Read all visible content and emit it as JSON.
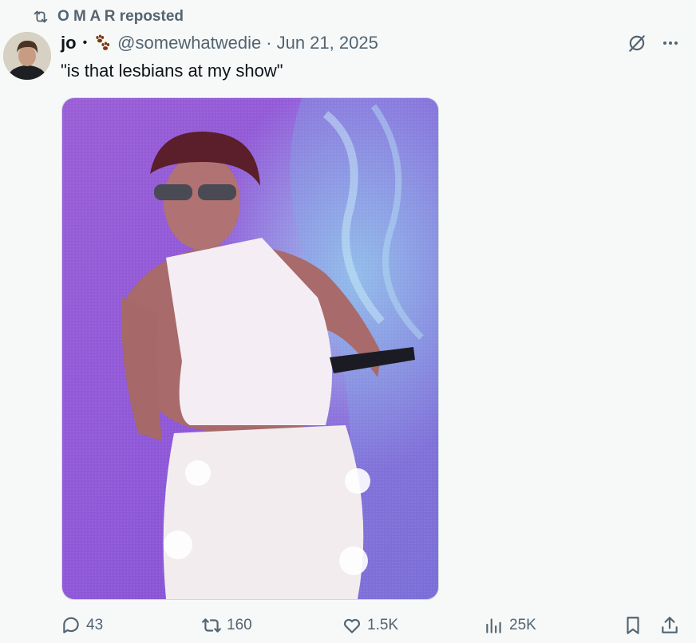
{
  "repost": {
    "text": "O M A R reposted",
    "icon": "repost-icon"
  },
  "tweet": {
    "author_name": "jo",
    "separator": "•",
    "emoji_icon": "paw-prints-icon",
    "handle": "@somewhatwedie",
    "date_sep": "·",
    "date": "Jun 21, 2025",
    "text": "\"is that lesbians at my show\"",
    "media_description_icon": "photo"
  },
  "header_icons": [
    "grok-icon",
    "more-icon"
  ],
  "actions": {
    "replies": "43",
    "reposts": "160",
    "likes": "1.5K",
    "views": "25K"
  },
  "colors": {
    "muted": "#536471",
    "text": "#0f1419",
    "background": "#f7f9f9"
  }
}
